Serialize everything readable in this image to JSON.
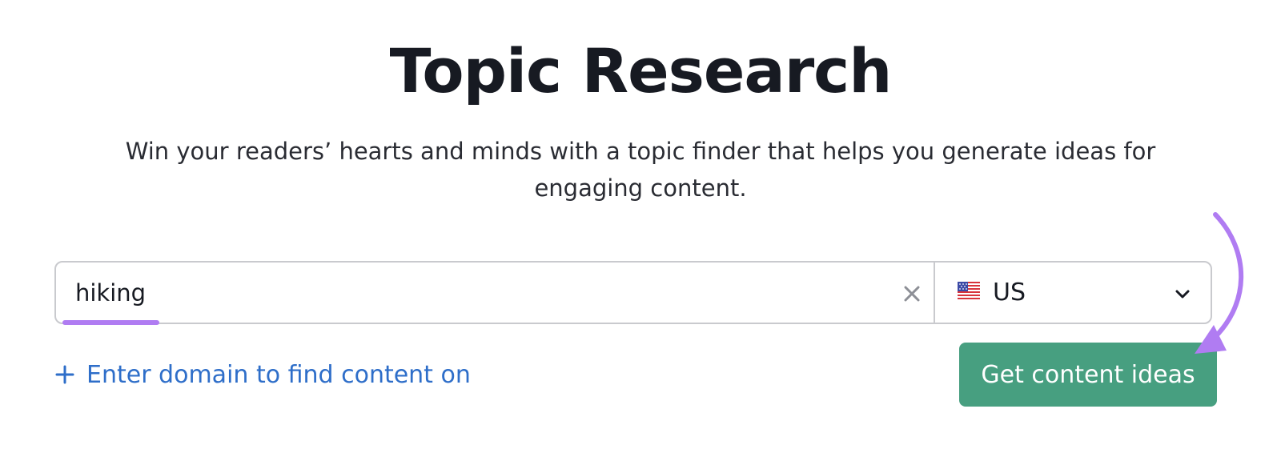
{
  "header": {
    "title": "Topic Research",
    "subtitle": "Win your readers’ hearts and minds with a topic finder that helps you generate ideas for engaging content."
  },
  "search": {
    "keyword_value": "hiking",
    "clear_icon": "close-icon",
    "country": {
      "flag_icon": "us-flag-icon",
      "label": "US",
      "dropdown_icon": "chevron-down-icon"
    }
  },
  "actions": {
    "add_domain_icon": "plus-icon",
    "add_domain_label": "Enter domain to find content on",
    "cta_label": "Get content ideas"
  },
  "colors": {
    "cta_background": "#479f80",
    "link": "#2e6ec9",
    "annotation": "#b07cf2",
    "border": "#c9cace"
  }
}
